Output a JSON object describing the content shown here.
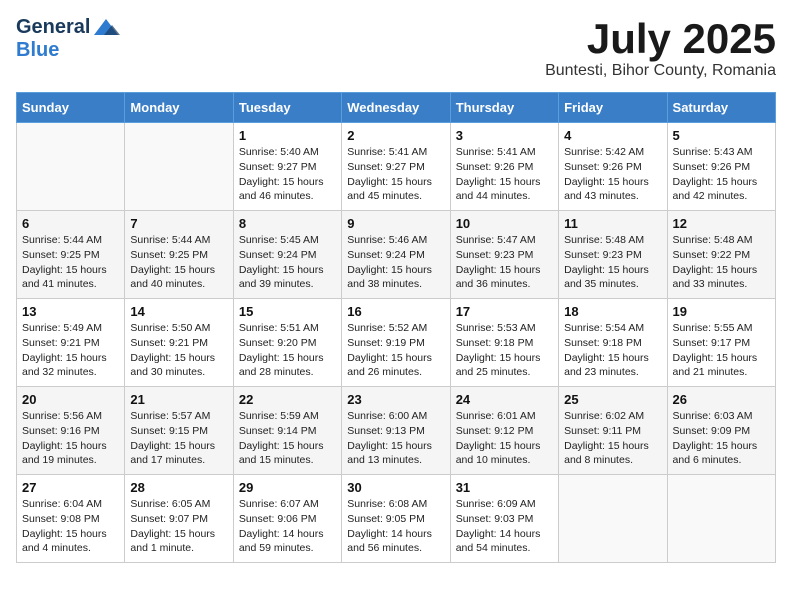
{
  "logo": {
    "general": "General",
    "blue": "Blue"
  },
  "title": "July 2025",
  "location": "Buntesti, Bihor County, Romania",
  "weekdays": [
    "Sunday",
    "Monday",
    "Tuesday",
    "Wednesday",
    "Thursday",
    "Friday",
    "Saturday"
  ],
  "weeks": [
    [
      {
        "day": "",
        "info": ""
      },
      {
        "day": "",
        "info": ""
      },
      {
        "day": "1",
        "info": "Sunrise: 5:40 AM\nSunset: 9:27 PM\nDaylight: 15 hours\nand 46 minutes."
      },
      {
        "day": "2",
        "info": "Sunrise: 5:41 AM\nSunset: 9:27 PM\nDaylight: 15 hours\nand 45 minutes."
      },
      {
        "day": "3",
        "info": "Sunrise: 5:41 AM\nSunset: 9:26 PM\nDaylight: 15 hours\nand 44 minutes."
      },
      {
        "day": "4",
        "info": "Sunrise: 5:42 AM\nSunset: 9:26 PM\nDaylight: 15 hours\nand 43 minutes."
      },
      {
        "day": "5",
        "info": "Sunrise: 5:43 AM\nSunset: 9:26 PM\nDaylight: 15 hours\nand 42 minutes."
      }
    ],
    [
      {
        "day": "6",
        "info": "Sunrise: 5:44 AM\nSunset: 9:25 PM\nDaylight: 15 hours\nand 41 minutes."
      },
      {
        "day": "7",
        "info": "Sunrise: 5:44 AM\nSunset: 9:25 PM\nDaylight: 15 hours\nand 40 minutes."
      },
      {
        "day": "8",
        "info": "Sunrise: 5:45 AM\nSunset: 9:24 PM\nDaylight: 15 hours\nand 39 minutes."
      },
      {
        "day": "9",
        "info": "Sunrise: 5:46 AM\nSunset: 9:24 PM\nDaylight: 15 hours\nand 38 minutes."
      },
      {
        "day": "10",
        "info": "Sunrise: 5:47 AM\nSunset: 9:23 PM\nDaylight: 15 hours\nand 36 minutes."
      },
      {
        "day": "11",
        "info": "Sunrise: 5:48 AM\nSunset: 9:23 PM\nDaylight: 15 hours\nand 35 minutes."
      },
      {
        "day": "12",
        "info": "Sunrise: 5:48 AM\nSunset: 9:22 PM\nDaylight: 15 hours\nand 33 minutes."
      }
    ],
    [
      {
        "day": "13",
        "info": "Sunrise: 5:49 AM\nSunset: 9:21 PM\nDaylight: 15 hours\nand 32 minutes."
      },
      {
        "day": "14",
        "info": "Sunrise: 5:50 AM\nSunset: 9:21 PM\nDaylight: 15 hours\nand 30 minutes."
      },
      {
        "day": "15",
        "info": "Sunrise: 5:51 AM\nSunset: 9:20 PM\nDaylight: 15 hours\nand 28 minutes."
      },
      {
        "day": "16",
        "info": "Sunrise: 5:52 AM\nSunset: 9:19 PM\nDaylight: 15 hours\nand 26 minutes."
      },
      {
        "day": "17",
        "info": "Sunrise: 5:53 AM\nSunset: 9:18 PM\nDaylight: 15 hours\nand 25 minutes."
      },
      {
        "day": "18",
        "info": "Sunrise: 5:54 AM\nSunset: 9:18 PM\nDaylight: 15 hours\nand 23 minutes."
      },
      {
        "day": "19",
        "info": "Sunrise: 5:55 AM\nSunset: 9:17 PM\nDaylight: 15 hours\nand 21 minutes."
      }
    ],
    [
      {
        "day": "20",
        "info": "Sunrise: 5:56 AM\nSunset: 9:16 PM\nDaylight: 15 hours\nand 19 minutes."
      },
      {
        "day": "21",
        "info": "Sunrise: 5:57 AM\nSunset: 9:15 PM\nDaylight: 15 hours\nand 17 minutes."
      },
      {
        "day": "22",
        "info": "Sunrise: 5:59 AM\nSunset: 9:14 PM\nDaylight: 15 hours\nand 15 minutes."
      },
      {
        "day": "23",
        "info": "Sunrise: 6:00 AM\nSunset: 9:13 PM\nDaylight: 15 hours\nand 13 minutes."
      },
      {
        "day": "24",
        "info": "Sunrise: 6:01 AM\nSunset: 9:12 PM\nDaylight: 15 hours\nand 10 minutes."
      },
      {
        "day": "25",
        "info": "Sunrise: 6:02 AM\nSunset: 9:11 PM\nDaylight: 15 hours\nand 8 minutes."
      },
      {
        "day": "26",
        "info": "Sunrise: 6:03 AM\nSunset: 9:09 PM\nDaylight: 15 hours\nand 6 minutes."
      }
    ],
    [
      {
        "day": "27",
        "info": "Sunrise: 6:04 AM\nSunset: 9:08 PM\nDaylight: 15 hours\nand 4 minutes."
      },
      {
        "day": "28",
        "info": "Sunrise: 6:05 AM\nSunset: 9:07 PM\nDaylight: 15 hours\nand 1 minute."
      },
      {
        "day": "29",
        "info": "Sunrise: 6:07 AM\nSunset: 9:06 PM\nDaylight: 14 hours\nand 59 minutes."
      },
      {
        "day": "30",
        "info": "Sunrise: 6:08 AM\nSunset: 9:05 PM\nDaylight: 14 hours\nand 56 minutes."
      },
      {
        "day": "31",
        "info": "Sunrise: 6:09 AM\nSunset: 9:03 PM\nDaylight: 14 hours\nand 54 minutes."
      },
      {
        "day": "",
        "info": ""
      },
      {
        "day": "",
        "info": ""
      }
    ]
  ]
}
